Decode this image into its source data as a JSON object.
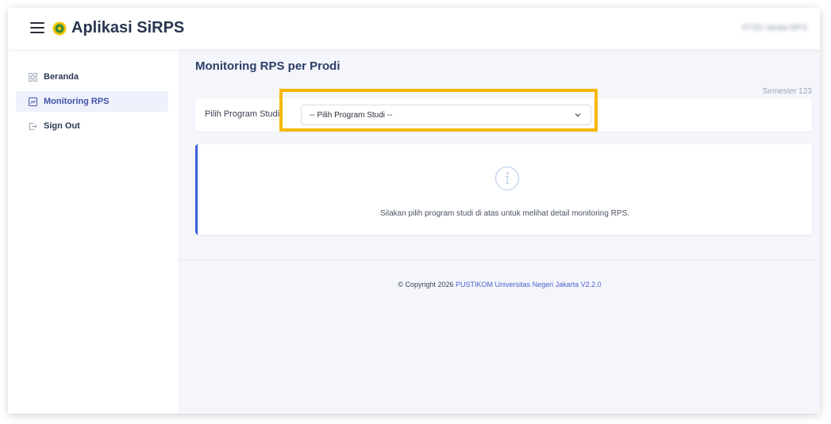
{
  "app": {
    "title": "Aplikasi SiRPS",
    "user_name": "STSD Vardia MPS",
    "accent_color": "#4354a8",
    "highlight_color": "#f5b800"
  },
  "sidebar": {
    "items": [
      {
        "label": "Beranda",
        "icon": "grid-icon",
        "active": false
      },
      {
        "label": "Monitoring RPS",
        "icon": "chart-file-icon",
        "active": true
      },
      {
        "label": "Sign Out",
        "icon": "sign-out-icon",
        "active": false
      }
    ]
  },
  "main": {
    "title": "Monitoring RPS per Prodi",
    "semester": "Semester 123",
    "filter": {
      "label": "Pilih Program Studi",
      "selected": "-- Pilih Program Studi --"
    },
    "info": {
      "icon": "info-icon",
      "message": "Silakan pilih program studi di atas untuk melihat detail monitoring RPS."
    }
  },
  "footer": {
    "prefix": "© Copyright 2026 ",
    "link": "PUSTIKOM Universitas Negeri Jakarta V2.2.0"
  }
}
